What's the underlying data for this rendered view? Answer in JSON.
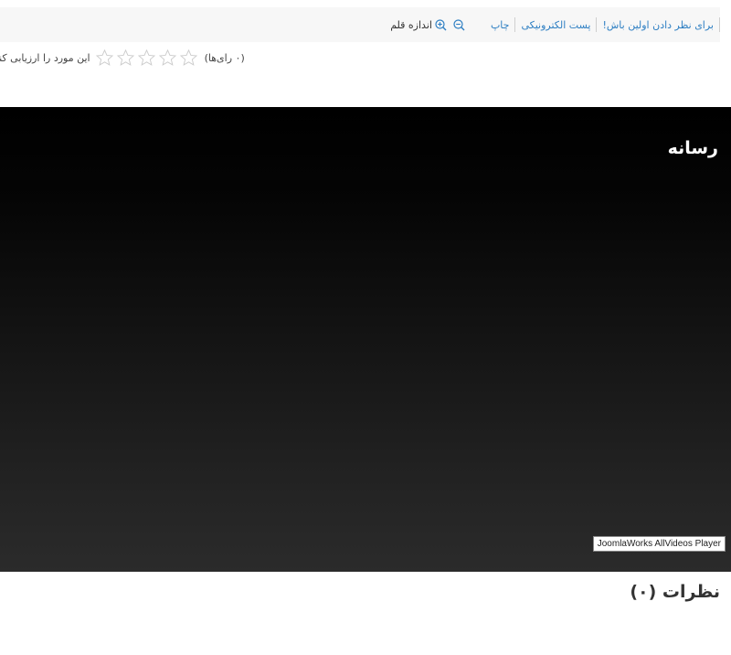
{
  "toolbar": {
    "font_size_label": "اندازه قلم",
    "zoom_in_icon": "zoom-in-icon",
    "zoom_out_icon": "zoom-out-icon",
    "print_label": "چاپ",
    "email_label": "پست الکترونیکی",
    "first_comment_label": "برای نظر دادن اولین باش!"
  },
  "rating": {
    "label": "این مورد را ارزیابی کنید",
    "stars_total": 5,
    "stars_filled": 0,
    "votes_label": "(۰ رای‌ها)",
    "star_color": "#cccccc"
  },
  "video": {
    "title": "رسانه",
    "player_credit": "JoomlaWorks AllVideos Player"
  },
  "comments": {
    "heading": "نظرات (۰)"
  },
  "colors": {
    "link": "#2e7fc3",
    "toolbar_bg": "#f7f7f7"
  }
}
